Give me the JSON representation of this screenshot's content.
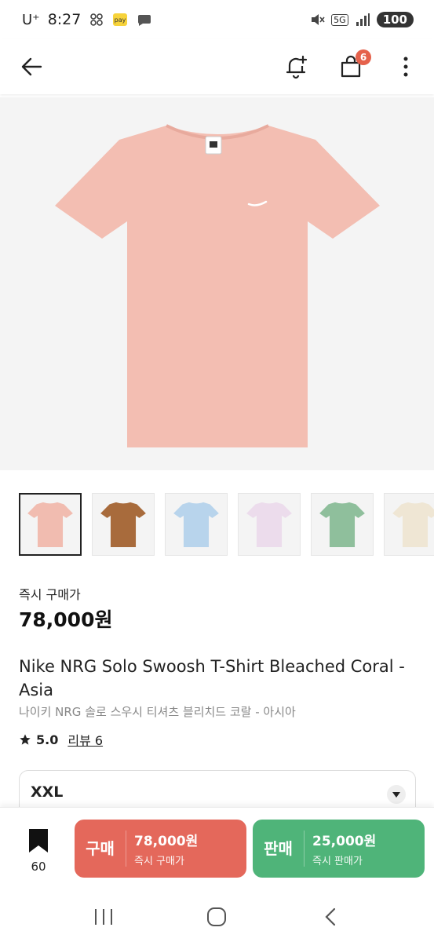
{
  "status_bar": {
    "carrier": "U⁺",
    "time": "8:27",
    "network": "5G",
    "battery": "100"
  },
  "header": {
    "back_icon": "arrow-left-icon",
    "notify_icon": "bell-plus-icon",
    "cart_icon": "shopping-bag-icon",
    "cart_count": "6",
    "more_icon": "more-vertical-icon"
  },
  "thumbnails": [
    {
      "color": "#f1bcb0",
      "active": true
    },
    {
      "color": "#a86b3c",
      "active": false
    },
    {
      "color": "#b8d4ec",
      "active": false
    },
    {
      "color": "#ecdcec",
      "active": false
    },
    {
      "color": "#8fbf9c",
      "active": false
    },
    {
      "color": "#efe6d4",
      "active": false
    }
  ],
  "product": {
    "price_label": "즉시 구매가",
    "price": "78,000원",
    "title_en": "Nike NRG Solo Swoosh T-Shirt Bleached Coral - Asia",
    "title_ko": "나이키 NRG 솔로 스우시 티셔츠 블리치드 코랄 - 아시아",
    "rating": "5.0",
    "reviews": "리뷰 6",
    "size": "XXL",
    "main_color": "#f3beb2"
  },
  "action_bar": {
    "bookmark_count": "60",
    "buy": {
      "label": "구매",
      "amount": "78,000원",
      "sub": "즉시 구매가",
      "color": "#e4685b"
    },
    "sell": {
      "label": "판매",
      "amount": "25,000원",
      "sub": "즉시 판매가",
      "color": "#4fb479"
    }
  }
}
